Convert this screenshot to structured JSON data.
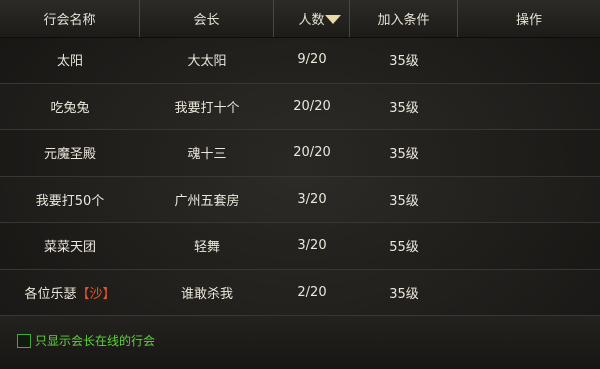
{
  "columns": {
    "name": "行会名称",
    "leader": "会长",
    "members": "人数",
    "requirement": "加入条件",
    "action": "操作"
  },
  "sort_icon": "triangle-down-icon",
  "guilds": [
    {
      "name": "太阳",
      "tag": "",
      "leader": "大太阳",
      "members": "9/20",
      "requirement": "35级"
    },
    {
      "name": "吃兔兔",
      "tag": "",
      "leader": "我要打十个",
      "members": "20/20",
      "requirement": "35级"
    },
    {
      "name": "元魔圣殿",
      "tag": "",
      "leader": "魂十三",
      "members": "20/20",
      "requirement": "35级"
    },
    {
      "name": "我要打50个",
      "tag": "",
      "leader": "广州五套房",
      "members": "3/20",
      "requirement": "35级"
    },
    {
      "name": "菜菜天团",
      "tag": "",
      "leader": "轻舞",
      "members": "3/20",
      "requirement": "55级"
    },
    {
      "name": "各位乐瑟",
      "tag": "【沙】",
      "leader": "谁敢杀我",
      "members": "2/20",
      "requirement": "35级"
    }
  ],
  "filter": {
    "label": "只显示会长在线的行会",
    "checked": false
  },
  "colors": {
    "text": "#ece7dc",
    "tag": "#e2552a",
    "filter": "#5cd23a"
  }
}
